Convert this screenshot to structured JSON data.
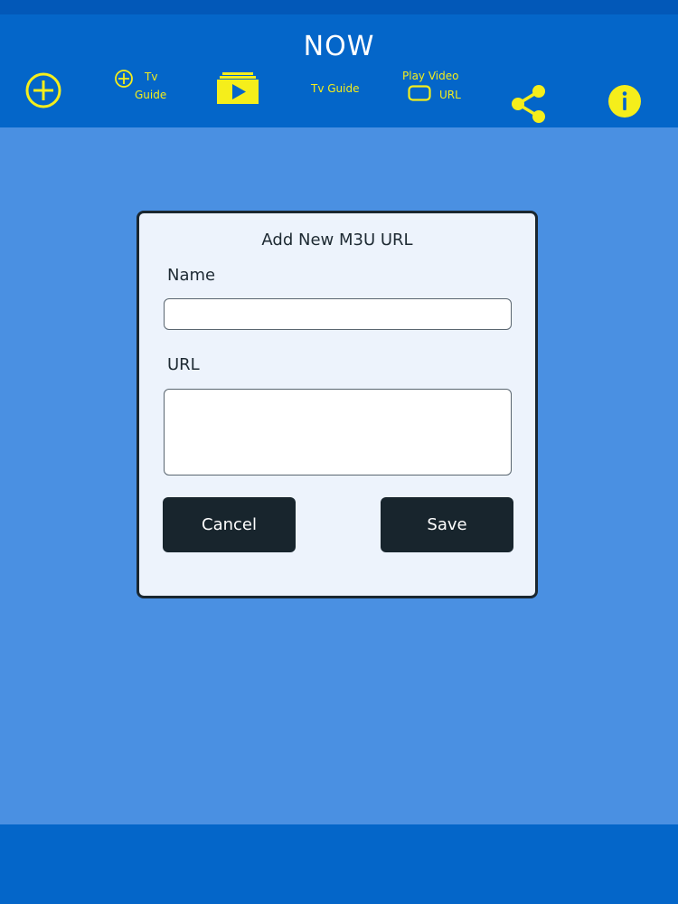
{
  "app": {
    "title": "NOW"
  },
  "toolbar": {
    "add_tv_guide_line1": "Tv",
    "add_tv_guide_line2": "Guide",
    "tv_guide": "Tv Guide",
    "play_video_line1": "Play Video",
    "play_video_line2": "URL",
    "icons": [
      "plus-circle-icon",
      "plus-circle-small-icon",
      "video-player-icon",
      "rectangle-icon",
      "share-icon",
      "info-icon"
    ]
  },
  "dialog": {
    "title": "Add New M3U URL",
    "name_label": "Name",
    "name_value": "",
    "url_label": "URL",
    "url_value": "",
    "cancel_label": "Cancel",
    "save_label": "Save"
  },
  "colors": {
    "background": "#4A90E2",
    "header": "#0466C9",
    "accent": "#F5EE1B",
    "dialog_bg": "#EDF3FC",
    "button_bg": "#18252D"
  }
}
